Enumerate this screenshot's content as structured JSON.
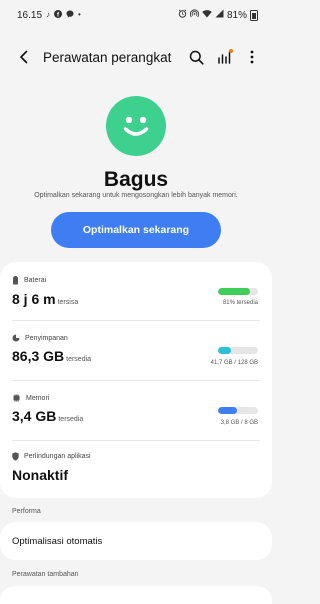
{
  "status_bar": {
    "time": "16.15",
    "battery_percent": "81%",
    "left_icons": [
      "tiktok-icon",
      "facebook-icon",
      "messenger-icon",
      "dot-icon"
    ],
    "right_icons": [
      "alarm-icon",
      "hotspot-icon",
      "wifi-icon",
      "signal-icon",
      "battery-icon"
    ]
  },
  "app_bar": {
    "title": "Perawatan perangkat"
  },
  "status": {
    "title": "Bagus",
    "subtitle": "Optimalkan sekarang untuk mengosongkan lebih banyak memori.",
    "button_label": "Optimalkan sekarang",
    "face_color": "#3ed08f"
  },
  "rows": {
    "battery": {
      "label": "Baterai",
      "value": "8 j 6 m",
      "unit": "tersisa",
      "caption": "81% tersedia",
      "level": 0.81,
      "color": "#3ecf5a"
    },
    "storage": {
      "label": "Penyimpanan",
      "value": "86,3 GB",
      "unit": "tersedia",
      "caption": "41,7 GB / 128 GB",
      "level": 0.33,
      "color": "#29c2d9"
    },
    "memory": {
      "label": "Memori",
      "value": "3,4 GB",
      "unit": "tersedia",
      "caption": "3,8 GB / 8 GB",
      "level": 0.48,
      "color": "#3e7ef2"
    },
    "app_protection": {
      "label": "Perlindungan aplikasi",
      "value": "Nonaktif"
    }
  },
  "sections": {
    "performance_header": "Performa",
    "auto_optimize": "Optimalisasi otomatis",
    "extra_header": "Perawatan tambahan"
  }
}
